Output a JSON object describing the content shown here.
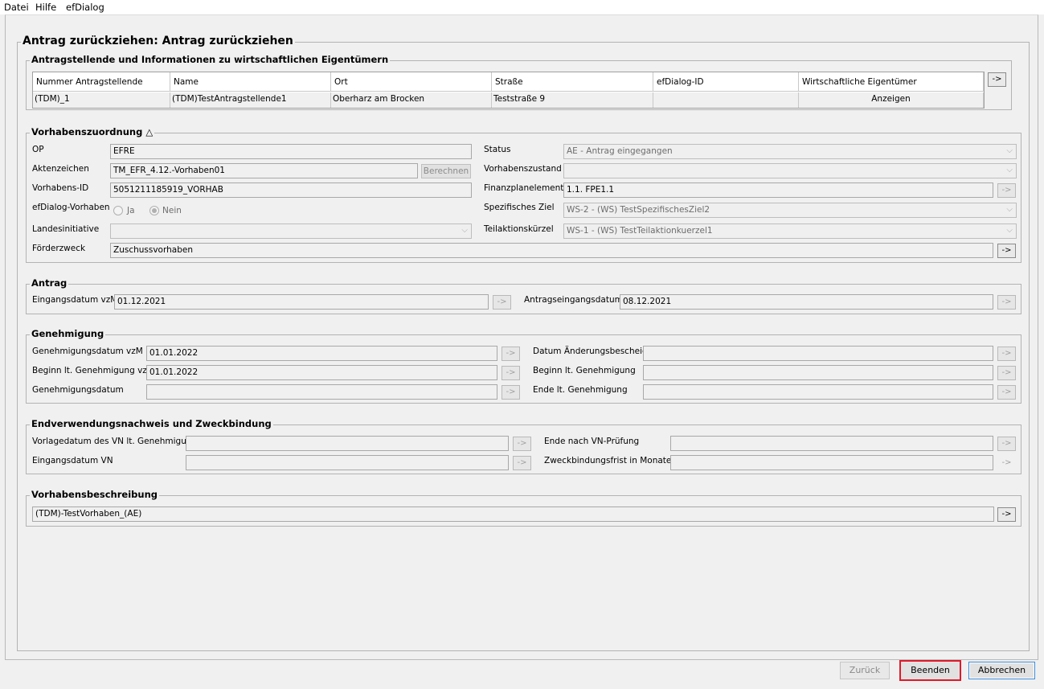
{
  "menu": {
    "items": [
      "Datei",
      "Hilfe",
      "efDialog"
    ]
  },
  "page": {
    "title": "Antrag zurückziehen: Antrag zurückziehen"
  },
  "applicants": {
    "legend": "Antragstellende und Informationen zu wirtschaftlichen Eigentümern",
    "columns": [
      "Nummer Antragstellende",
      "Name",
      "Ort",
      "Straße",
      "efDialog-ID",
      "Wirtschaftliche Eigentümer"
    ],
    "rows": [
      [
        "(TDM)_1",
        "(TDM)TestAntragstellende1",
        "Oberharz am Brocken",
        "Teststraße 9",
        "",
        "Anzeigen"
      ]
    ],
    "side_button": "->"
  },
  "assignment": {
    "legend": "Vorhabenszuordnung",
    "op_label": "OP",
    "op_value": "EFRE",
    "aktenzeichen_label": "Aktenzeichen",
    "aktenzeichen_value": "TM_EFR_4.12.-Vorhaben01",
    "berechnen_label": "Berechnen",
    "vorhabens_id_label": "Vorhabens-ID",
    "vorhabens_id_value": "5051211185919_VORHAB",
    "efdialog_label": "efDialog-Vorhaben",
    "radio_ja": "Ja",
    "radio_nein": "Nein",
    "landesinitiative_label": "Landesinitiative",
    "landesinitiative_value": "",
    "foerderzweck_label": "Förderzweck",
    "foerderzweck_value": "Zuschussvorhaben",
    "status_label": "Status",
    "status_value": "AE - Antrag eingegangen",
    "vorhabenszustand_label": "Vorhabenszustand",
    "vorhabenszustand_value": "",
    "finanzplanelement_label": "Finanzplanelement",
    "finanzplanelement_value": "1.1. FPE1.1",
    "spezifisches_ziel_label": "Spezifisches Ziel",
    "spezifisches_ziel_value": "WS-2 - (WS) TestSpezifischesZiel2",
    "teilaktion_label": "Teilaktionskürzel",
    "teilaktion_value": "WS-1 - (WS) TestTeilaktionkuerzel1",
    "arrow": "->"
  },
  "antrag": {
    "legend": "Antrag",
    "eingangsdatum_label": "Eingangsdatum vzM",
    "eingangsdatum_value": "01.12.2021",
    "antragseingangsdatum_label": "Antragseingangsdatum",
    "antragseingangsdatum_value": "08.12.2021",
    "arrow": "->"
  },
  "genehmigung": {
    "legend": "Genehmigung",
    "genehmigungsdatum_vzm_label": "Genehmigungsdatum vzM",
    "genehmigungsdatum_vzm_value": "01.01.2022",
    "beginn_vzm_label": "Beginn lt. Genehmigung vzM",
    "beginn_vzm_value": "01.01.2022",
    "genehmigungsdatum_label": "Genehmigungsdatum",
    "genehmigungsdatum_value": "",
    "datum_aenderung_label": "Datum Änderungsbescheid",
    "datum_aenderung_value": "",
    "beginn_label": "Beginn lt. Genehmigung",
    "beginn_value": "",
    "ende_label": "Ende lt. Genehmigung",
    "ende_value": "",
    "arrow": "->"
  },
  "endverwendung": {
    "legend": "Endverwendungsnachweis und Zweckbindung",
    "vorlagedatum_label": "Vorlagedatum des VN lt. Genehmigung",
    "vorlagedatum_value": "",
    "eingangsdatum_vn_label": "Eingangsdatum VN",
    "eingangsdatum_vn_value": "",
    "ende_vn_label": "Ende nach VN-Prüfung",
    "ende_vn_value": "",
    "zweckbindung_label": "Zweckbindungsfrist in Monaten",
    "zweckbindung_value": "",
    "arrow": "->"
  },
  "beschreibung": {
    "legend": "Vorhabensbeschreibung",
    "value": "(TDM)-TestVorhaben_(AE)",
    "arrow": "->"
  },
  "footer": {
    "zurueck": "Zurück",
    "beenden": "Beenden",
    "abbrechen": "Abbrechen"
  },
  "colors": {
    "highlight": "#e0192a",
    "focus": "#3b8bd9"
  }
}
